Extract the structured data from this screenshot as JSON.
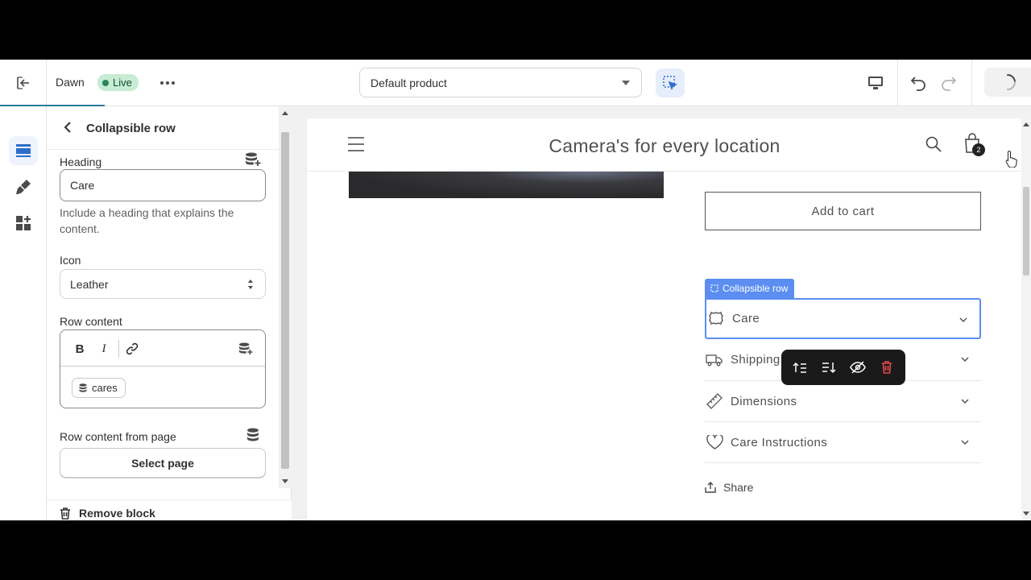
{
  "topbar": {
    "theme_name": "Dawn",
    "live_label": "Live",
    "template_value": "Default product"
  },
  "panel": {
    "title": "Collapsible row",
    "heading_label": "Heading",
    "heading_value": "Care",
    "heading_help": "Include a heading that explains the content.",
    "icon_label": "Icon",
    "icon_value": "Leather",
    "row_content_label": "Row content",
    "rte_bold": "B",
    "rte_italic": "I",
    "source_value": "cares",
    "row_content_page_label": "Row content from page",
    "select_page_label": "Select page",
    "remove_label": "Remove block"
  },
  "preview": {
    "store_title": "Camera's for every location",
    "cart_count": "2",
    "add_to_cart": "Add to cart",
    "block_tag": "Collapsible row",
    "rows": [
      {
        "label": "Care",
        "icon": "leather-icon"
      },
      {
        "label": "Shipping",
        "icon": "truck-icon"
      },
      {
        "label": "Dimensions",
        "icon": "ruler-icon"
      },
      {
        "label": "Care Instructions",
        "icon": "heart-icon"
      }
    ],
    "share_label": "Share"
  },
  "colors": {
    "accent_blue": "#5b8ef0",
    "live_green": "#29845a",
    "delete_red": "#e5484d"
  }
}
